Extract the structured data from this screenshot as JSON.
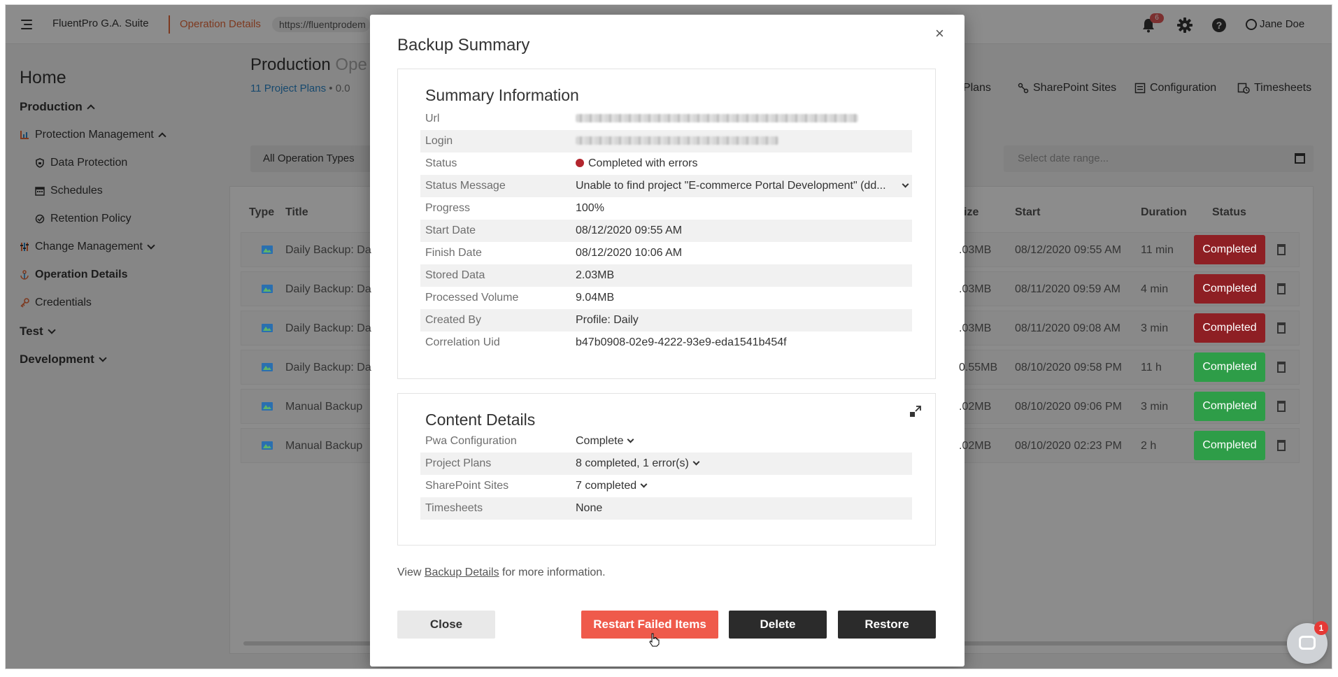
{
  "header": {
    "suite_name": "FluentPro G.A. Suite",
    "breadcrumb": "Operation Details",
    "url": "https://fluentprodem",
    "notifications_count": "6",
    "help_label": "?",
    "user_name": "Jane Doe"
  },
  "sidebar": {
    "home": "Home",
    "items": [
      {
        "label": "Production"
      },
      {
        "label": "Protection Management"
      },
      {
        "label": "Data Protection"
      },
      {
        "label": "Schedules"
      },
      {
        "label": "Retention Policy"
      },
      {
        "label": "Change Management"
      },
      {
        "label": "Operation Details"
      },
      {
        "label": "Credentials"
      },
      {
        "label": "Test"
      },
      {
        "label": "Development"
      }
    ]
  },
  "main": {
    "title": "Production",
    "title_muted": "Ope",
    "project_plans_link": "11 Project Plans",
    "links_muted": "• 0.0",
    "tabs": [
      {
        "label": "ct Plans"
      },
      {
        "label": "SharePoint Sites"
      },
      {
        "label": "Configuration"
      },
      {
        "label": "Timesheets"
      }
    ],
    "filter_label": "All Operation Types",
    "date_placeholder": "Select date range...",
    "columns": {
      "type": "Type",
      "title": "Title",
      "size": "ize",
      "start": "Start",
      "duration": "Duration",
      "status": "Status"
    },
    "rows": [
      {
        "title": "Daily Backup: Da",
        "size": ".03MB",
        "start": "08/12/2020 09:55 AM",
        "duration": "11 min",
        "status": "Completed",
        "status_color": "#8e1f24"
      },
      {
        "title": "Daily Backup: Da",
        "size": ".03MB",
        "start": "08/11/2020 09:59 AM",
        "duration": "4 min",
        "status": "Completed",
        "status_color": "#8e1f24"
      },
      {
        "title": "Daily Backup: Da",
        "size": ".03MB",
        "start": "08/11/2020 09:08 AM",
        "duration": "3 min",
        "status": "Completed",
        "status_color": "#8e1f24"
      },
      {
        "title": "Daily Backup: Da",
        "size": "0.55MB",
        "start": "08/10/2020 09:58 PM",
        "duration": "11 h",
        "status": "Completed",
        "status_color": "#2e9d48"
      },
      {
        "title": "Manual Backup",
        "size": ".02MB",
        "start": "08/10/2020 09:06 PM",
        "duration": "3 min",
        "status": "Completed",
        "status_color": "#2e9d48"
      },
      {
        "title": "Manual Backup",
        "size": ".02MB",
        "start": "08/10/2020 02:23 PM",
        "duration": "2 h",
        "status": "Completed",
        "status_color": "#2e9d48"
      }
    ]
  },
  "modal": {
    "title": "Backup Summary",
    "close_glyph": "×",
    "summary": {
      "title": "Summary Information",
      "fields": [
        {
          "key": "Url"
        },
        {
          "key": "Login"
        },
        {
          "key": "Status",
          "value": "Completed with errors"
        },
        {
          "key": "Status Message",
          "value": "Unable to find project \"E-commerce Portal Development\" (dd..."
        },
        {
          "key": "Progress",
          "value": "100%"
        },
        {
          "key": "Start Date",
          "value": "08/12/2020 09:55 AM"
        },
        {
          "key": "Finish Date",
          "value": "08/12/2020 10:06 AM"
        },
        {
          "key": "Stored Data",
          "value": "2.03MB"
        },
        {
          "key": "Processed Volume",
          "value": "9.04MB"
        },
        {
          "key": "Created By",
          "value": "Profile: Daily"
        },
        {
          "key": "Correlation Uid",
          "value": "b47b0908-02e9-4222-93e9-eda1541b454f"
        }
      ]
    },
    "content": {
      "title": "Content Details",
      "fields": [
        {
          "key": "Pwa Configuration",
          "value": "Complete"
        },
        {
          "key": "Project Plans",
          "value": "8 completed, 1 error(s)"
        },
        {
          "key": "SharePoint Sites",
          "value": "7 completed"
        },
        {
          "key": "Timesheets",
          "value": "None"
        }
      ]
    },
    "footnote_prefix": "View",
    "footnote_link": "Backup Details",
    "footnote_suffix": "for more information.",
    "buttons": {
      "close": "Close",
      "restart": "Restart Failed Items",
      "delete": "Delete",
      "restore": "Restore"
    },
    "colors": {
      "restart": "#ef5a4b",
      "dark": "#2b2b2b",
      "error_dot": "#b3262e"
    }
  },
  "chat": {
    "badge": "1"
  }
}
